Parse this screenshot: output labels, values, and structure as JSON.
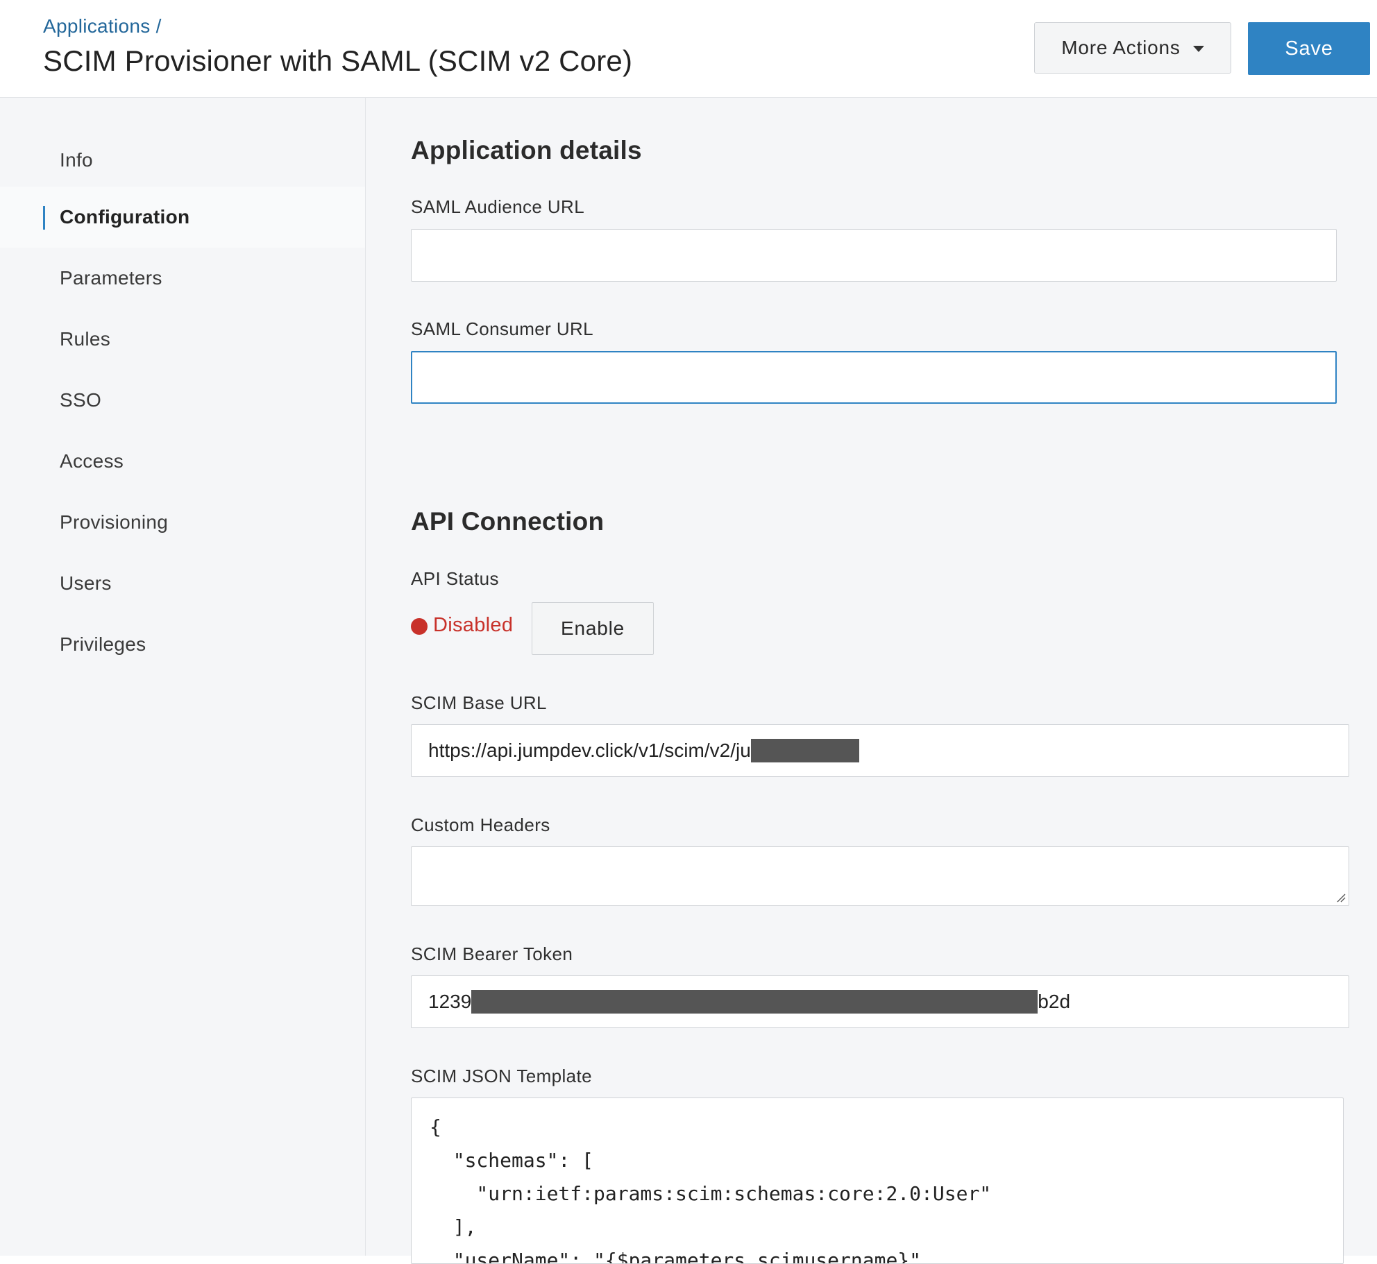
{
  "header": {
    "breadcrumb": "Applications",
    "breadcrumb_sep": "/",
    "title": "SCIM Provisioner with SAML (SCIM v2 Core)",
    "more_actions_label": "More Actions",
    "save_label": "Save"
  },
  "sidebar": {
    "items": [
      {
        "label": "Info"
      },
      {
        "label": "Configuration",
        "active": true
      },
      {
        "label": "Parameters"
      },
      {
        "label": "Rules"
      },
      {
        "label": "SSO"
      },
      {
        "label": "Access"
      },
      {
        "label": "Provisioning"
      },
      {
        "label": "Users"
      },
      {
        "label": "Privileges"
      }
    ]
  },
  "app_details": {
    "title": "Application details",
    "saml_audience_label": "SAML Audience URL",
    "saml_audience_value": "",
    "saml_consumer_label": "SAML Consumer URL",
    "saml_consumer_value": ""
  },
  "api": {
    "title": "API Connection",
    "status_label": "API Status",
    "status_value": "Disabled",
    "status_color": "#c8312a",
    "enable_label": "Enable",
    "base_url_label": "SCIM Base URL",
    "base_url_visible": "https://api.jumpdev.click/v1/scim/v2/ju",
    "custom_headers_label": "Custom Headers",
    "custom_headers_value": "",
    "bearer_label": "SCIM Bearer Token",
    "bearer_prefix": "1239",
    "bearer_suffix": "b2d",
    "json_label": "SCIM JSON Template",
    "json_lines": [
      "{",
      "  \"schemas\": [",
      "    \"urn:ietf:params:scim:schemas:core:2.0:User\"",
      "  ],",
      "  \"userName\": \"{$parameters.scimusername}\","
    ]
  },
  "colors": {
    "accent": "#2f83c3",
    "link": "#23679a",
    "sidebar_bg": "#f5f6f8"
  }
}
